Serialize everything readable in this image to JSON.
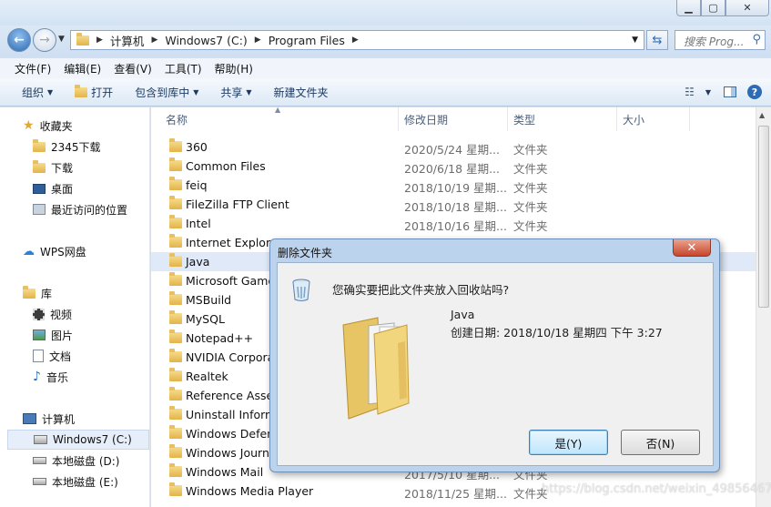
{
  "window": {
    "minimize_icon": "minimize-icon",
    "maximize_icon": "maximize-icon",
    "close_icon": "close-icon"
  },
  "address": {
    "crumbs": [
      "计算机",
      "Windows7 (C:)",
      "Program Files"
    ]
  },
  "search": {
    "placeholder": "搜索 Prog..."
  },
  "menubar": [
    "文件(F)",
    "编辑(E)",
    "查看(V)",
    "工具(T)",
    "帮助(H)"
  ],
  "toolbar": {
    "organize": "组织",
    "open": "打开",
    "include_library": "包含到库中",
    "share": "共享",
    "new_folder": "新建文件夹"
  },
  "nav": {
    "favorites": "收藏夹",
    "fav_items": [
      "2345下载",
      "下载",
      "桌面",
      "最近访问的位置"
    ],
    "wps": "WPS网盘",
    "libraries": "库",
    "lib_items": [
      "视频",
      "图片",
      "文档",
      "音乐"
    ],
    "computer": "计算机",
    "drives": [
      "Windows7 (C:)",
      "本地磁盘 (D:)",
      "本地磁盘 (E:)"
    ]
  },
  "columns": {
    "name": "名称",
    "date": "修改日期",
    "type": "类型",
    "size": "大小"
  },
  "files": [
    {
      "name": "360",
      "date": "2020/5/24 星期...",
      "type": "文件夹"
    },
    {
      "name": "Common Files",
      "date": "2020/6/18 星期...",
      "type": "文件夹"
    },
    {
      "name": "feiq",
      "date": "2018/10/19 星期...",
      "type": "文件夹"
    },
    {
      "name": "FileZilla FTP Client",
      "date": "2018/10/18 星期...",
      "type": "文件夹"
    },
    {
      "name": "Intel",
      "date": "2018/10/16 星期...",
      "type": "文件夹"
    },
    {
      "name": "Internet Explorer",
      "date": "",
      "type": ""
    },
    {
      "name": "Java",
      "date": "",
      "type": ""
    },
    {
      "name": "Microsoft Games",
      "date": "",
      "type": ""
    },
    {
      "name": "MSBuild",
      "date": "",
      "type": ""
    },
    {
      "name": "MySQL",
      "date": "",
      "type": ""
    },
    {
      "name": "Notepad++",
      "date": "",
      "type": ""
    },
    {
      "name": "NVIDIA Corporation",
      "date": "",
      "type": ""
    },
    {
      "name": "Realtek",
      "date": "",
      "type": ""
    },
    {
      "name": "Reference Assemblies",
      "date": "",
      "type": ""
    },
    {
      "name": "Uninstall Information",
      "date": "",
      "type": ""
    },
    {
      "name": "Windows Defender",
      "date": "",
      "type": ""
    },
    {
      "name": "Windows Journal",
      "date": "",
      "type": ""
    },
    {
      "name": "Windows Mail",
      "date": "2017/5/10 星期...",
      "type": "文件夹"
    },
    {
      "name": "Windows Media Player",
      "date": "2018/11/25 星期...",
      "type": "文件夹"
    }
  ],
  "dialog": {
    "title": "删除文件夹",
    "close": "✕",
    "question": "您确实要把此文件夹放入回收站吗?",
    "item_name": "Java",
    "item_created": "创建日期: 2018/10/18 星期四 下午 3:27",
    "yes": "是(Y)",
    "no": "否(N)"
  },
  "watermark": "https://blog.csdn.net/weixin_49856467",
  "colors": {
    "accent": "#3c7fb1",
    "folder": "#e3b34a",
    "selection": "#dfe9f7"
  }
}
